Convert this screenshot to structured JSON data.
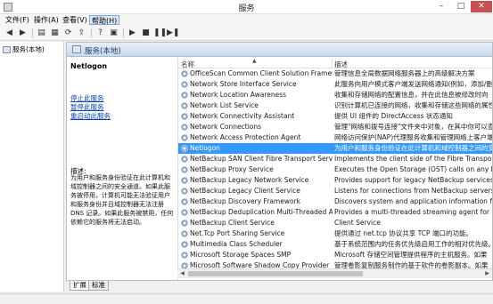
{
  "window": {
    "title": "服务",
    "minimize": "–",
    "maximize": "□",
    "close": "✕"
  },
  "menu": [
    {
      "label": "文件(F)",
      "active": false
    },
    {
      "label": "操作(A)",
      "active": false
    },
    {
      "label": "查看(V)",
      "active": false
    },
    {
      "label": "帮助(H)",
      "active": true
    }
  ],
  "toolbar": [
    {
      "name": "back-icon",
      "glyph": "◀"
    },
    {
      "name": "forward-icon",
      "glyph": "▶"
    },
    {
      "name": "sep"
    },
    {
      "name": "console-tree-icon",
      "glyph": "▤"
    },
    {
      "name": "properties-icon",
      "glyph": "▦"
    },
    {
      "name": "refresh-icon",
      "glyph": "⟳"
    },
    {
      "name": "export-icon",
      "glyph": "⇪"
    },
    {
      "name": "sep"
    },
    {
      "name": "help-icon",
      "glyph": "?"
    },
    {
      "name": "view-icon",
      "glyph": "▣"
    },
    {
      "name": "sep"
    },
    {
      "name": "start-service-icon",
      "glyph": "▶"
    },
    {
      "name": "stop-service-icon",
      "glyph": "■"
    },
    {
      "name": "pause-service-icon",
      "glyph": "❚❚"
    },
    {
      "name": "restart-service-icon",
      "glyph": "▶❚"
    }
  ],
  "tree": {
    "root_label": "服务(本地)"
  },
  "panel": {
    "title": "服务(本地)"
  },
  "detail": {
    "service_name": "Netlogon",
    "stop_link": "停止此服务",
    "pause_link": "暂停此服务",
    "restart_link": "重启动此服务",
    "description_label": "描述:",
    "description": "为用户和服务身份验证在此计算机和域控制器之间的安全通道。如果此服务被停用，计算机可能无法验证用户和服务身份并且域控制器无法注册 DNS 记录。如果此服务被禁用，任何依赖它的服务将无法启动。"
  },
  "columns": {
    "name": "名称",
    "description": "描述",
    "sort_indicator": "▲"
  },
  "services": [
    {
      "name": "OfficeScan Common Client Solution Framework",
      "description": "管理信息全局数据网络服务器上的高级解决方案"
    },
    {
      "name": "Network Store Interface Service",
      "description": "此服务向用户模式客户端发送网络通知(例如，添加/删"
    },
    {
      "name": "Network Location Awareness",
      "description": "收集和存储网络的配置信息，并在此信息被修改时向"
    },
    {
      "name": "Network List Service",
      "description": "识别计算机已连接的网络，收集和存储这些网络的属性"
    },
    {
      "name": "Network Connectivity Assistant",
      "description": "提供 UI 组件的 DirectAccess 状态通知"
    },
    {
      "name": "Network Connections",
      "description": "管理\"网络和拨号连接\"文件夹中对象，在其中你可以查"
    },
    {
      "name": "Network Access Protection Agent",
      "description": "网络访问保护(NAP)代理服务收集和管理网络上客户端"
    },
    {
      "name": "Netlogon",
      "description": "为用户和服务身份验证在此计算机和域控制器之间的安"
    },
    {
      "name": "NetBackup SAN Client Fibre Transport Service",
      "description": "Implements the client side of the Fibre Transport"
    },
    {
      "name": "NetBackup Proxy Service",
      "description": "Executes the Open Storage (OST) calls on any host"
    },
    {
      "name": "NetBackup Legacy Network Service",
      "description": "Provides support for legacy NetBackup services."
    },
    {
      "name": "NetBackup Legacy Client Service",
      "description": "Listens for connections from NetBackup servers"
    },
    {
      "name": "NetBackup Discovery Framework",
      "description": "Discovers system and application information for"
    },
    {
      "name": "NetBackup Deduplication Multi-Threaded Agent",
      "description": "Provides a multi-threaded streaming agent for i"
    },
    {
      "name": "NetBackup Client Service",
      "description": "Client Service"
    },
    {
      "name": "Net.Tcp Port Sharing Service",
      "description": "提供通过 net.tcp 协议共享 TCP 端口的功能。"
    },
    {
      "name": "Multimedia Class Scheduler",
      "description": "基于系统范围内的任务优先级启用工作的相对优先级。"
    },
    {
      "name": "Microsoft Storage Spaces SMP",
      "description": "Microsoft 存储空间管理提供程序的主机服务。如果"
    },
    {
      "name": "Microsoft Software Shadow Copy Provider",
      "description": "管理卷影复制服务制作的基于软件的卷影副本。如果"
    }
  ],
  "selected_index": 7,
  "tabs": [
    {
      "label": "扩展",
      "active": true
    },
    {
      "label": "标准",
      "active": false
    }
  ],
  "colors": {
    "selection": "#3399ff",
    "link": "#0645ad",
    "close_button": "#c75050",
    "panel_header": "#cad9ec"
  }
}
